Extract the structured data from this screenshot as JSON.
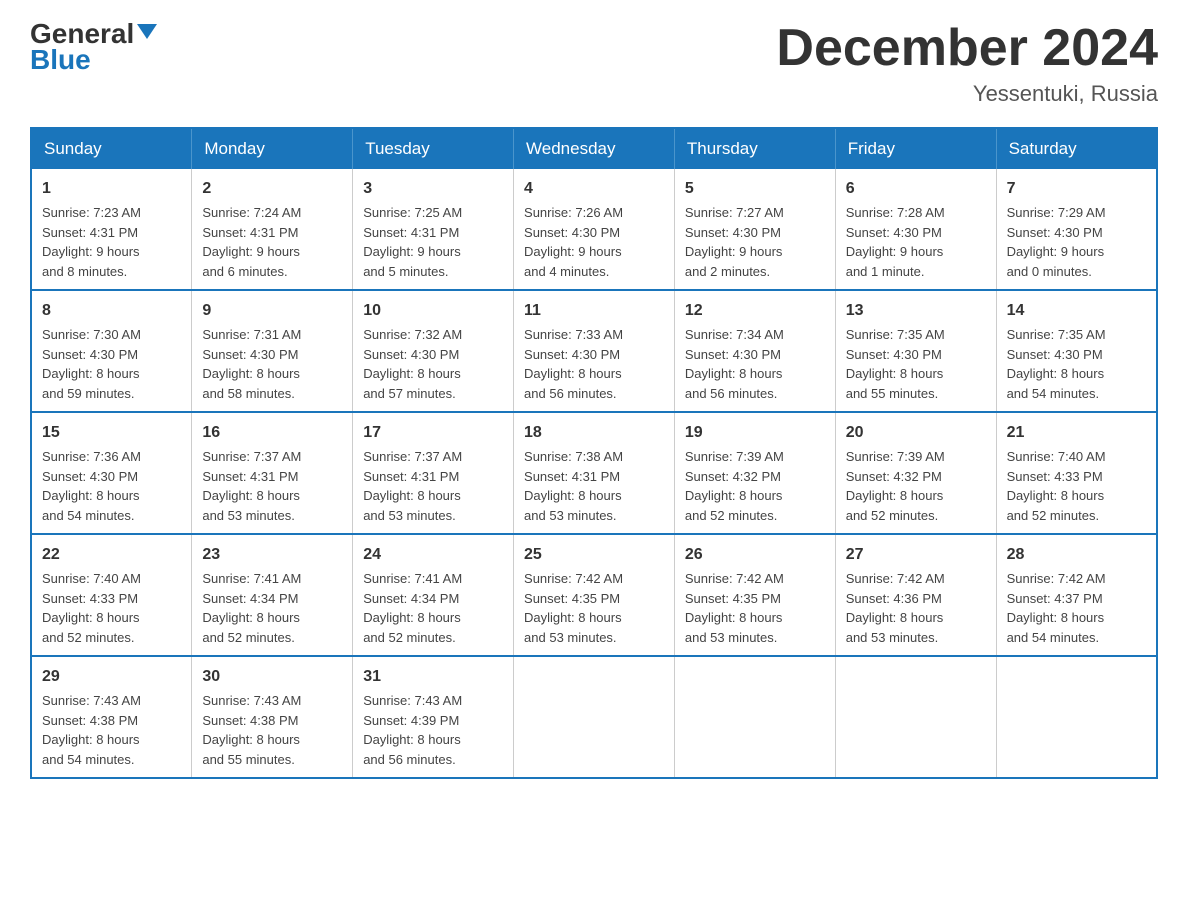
{
  "header": {
    "logo_line1": "General",
    "logo_line2": "Blue",
    "month_title": "December 2024",
    "location": "Yessentuki, Russia"
  },
  "days_of_week": [
    "Sunday",
    "Monday",
    "Tuesday",
    "Wednesday",
    "Thursday",
    "Friday",
    "Saturday"
  ],
  "weeks": [
    [
      {
        "day": "1",
        "sunrise": "Sunrise: 7:23 AM",
        "sunset": "Sunset: 4:31 PM",
        "daylight": "Daylight: 9 hours",
        "daylight2": "and 8 minutes."
      },
      {
        "day": "2",
        "sunrise": "Sunrise: 7:24 AM",
        "sunset": "Sunset: 4:31 PM",
        "daylight": "Daylight: 9 hours",
        "daylight2": "and 6 minutes."
      },
      {
        "day": "3",
        "sunrise": "Sunrise: 7:25 AM",
        "sunset": "Sunset: 4:31 PM",
        "daylight": "Daylight: 9 hours",
        "daylight2": "and 5 minutes."
      },
      {
        "day": "4",
        "sunrise": "Sunrise: 7:26 AM",
        "sunset": "Sunset: 4:30 PM",
        "daylight": "Daylight: 9 hours",
        "daylight2": "and 4 minutes."
      },
      {
        "day": "5",
        "sunrise": "Sunrise: 7:27 AM",
        "sunset": "Sunset: 4:30 PM",
        "daylight": "Daylight: 9 hours",
        "daylight2": "and 2 minutes."
      },
      {
        "day": "6",
        "sunrise": "Sunrise: 7:28 AM",
        "sunset": "Sunset: 4:30 PM",
        "daylight": "Daylight: 9 hours",
        "daylight2": "and 1 minute."
      },
      {
        "day": "7",
        "sunrise": "Sunrise: 7:29 AM",
        "sunset": "Sunset: 4:30 PM",
        "daylight": "Daylight: 9 hours",
        "daylight2": "and 0 minutes."
      }
    ],
    [
      {
        "day": "8",
        "sunrise": "Sunrise: 7:30 AM",
        "sunset": "Sunset: 4:30 PM",
        "daylight": "Daylight: 8 hours",
        "daylight2": "and 59 minutes."
      },
      {
        "day": "9",
        "sunrise": "Sunrise: 7:31 AM",
        "sunset": "Sunset: 4:30 PM",
        "daylight": "Daylight: 8 hours",
        "daylight2": "and 58 minutes."
      },
      {
        "day": "10",
        "sunrise": "Sunrise: 7:32 AM",
        "sunset": "Sunset: 4:30 PM",
        "daylight": "Daylight: 8 hours",
        "daylight2": "and 57 minutes."
      },
      {
        "day": "11",
        "sunrise": "Sunrise: 7:33 AM",
        "sunset": "Sunset: 4:30 PM",
        "daylight": "Daylight: 8 hours",
        "daylight2": "and 56 minutes."
      },
      {
        "day": "12",
        "sunrise": "Sunrise: 7:34 AM",
        "sunset": "Sunset: 4:30 PM",
        "daylight": "Daylight: 8 hours",
        "daylight2": "and 56 minutes."
      },
      {
        "day": "13",
        "sunrise": "Sunrise: 7:35 AM",
        "sunset": "Sunset: 4:30 PM",
        "daylight": "Daylight: 8 hours",
        "daylight2": "and 55 minutes."
      },
      {
        "day": "14",
        "sunrise": "Sunrise: 7:35 AM",
        "sunset": "Sunset: 4:30 PM",
        "daylight": "Daylight: 8 hours",
        "daylight2": "and 54 minutes."
      }
    ],
    [
      {
        "day": "15",
        "sunrise": "Sunrise: 7:36 AM",
        "sunset": "Sunset: 4:30 PM",
        "daylight": "Daylight: 8 hours",
        "daylight2": "and 54 minutes."
      },
      {
        "day": "16",
        "sunrise": "Sunrise: 7:37 AM",
        "sunset": "Sunset: 4:31 PM",
        "daylight": "Daylight: 8 hours",
        "daylight2": "and 53 minutes."
      },
      {
        "day": "17",
        "sunrise": "Sunrise: 7:37 AM",
        "sunset": "Sunset: 4:31 PM",
        "daylight": "Daylight: 8 hours",
        "daylight2": "and 53 minutes."
      },
      {
        "day": "18",
        "sunrise": "Sunrise: 7:38 AM",
        "sunset": "Sunset: 4:31 PM",
        "daylight": "Daylight: 8 hours",
        "daylight2": "and 53 minutes."
      },
      {
        "day": "19",
        "sunrise": "Sunrise: 7:39 AM",
        "sunset": "Sunset: 4:32 PM",
        "daylight": "Daylight: 8 hours",
        "daylight2": "and 52 minutes."
      },
      {
        "day": "20",
        "sunrise": "Sunrise: 7:39 AM",
        "sunset": "Sunset: 4:32 PM",
        "daylight": "Daylight: 8 hours",
        "daylight2": "and 52 minutes."
      },
      {
        "day": "21",
        "sunrise": "Sunrise: 7:40 AM",
        "sunset": "Sunset: 4:33 PM",
        "daylight": "Daylight: 8 hours",
        "daylight2": "and 52 minutes."
      }
    ],
    [
      {
        "day": "22",
        "sunrise": "Sunrise: 7:40 AM",
        "sunset": "Sunset: 4:33 PM",
        "daylight": "Daylight: 8 hours",
        "daylight2": "and 52 minutes."
      },
      {
        "day": "23",
        "sunrise": "Sunrise: 7:41 AM",
        "sunset": "Sunset: 4:34 PM",
        "daylight": "Daylight: 8 hours",
        "daylight2": "and 52 minutes."
      },
      {
        "day": "24",
        "sunrise": "Sunrise: 7:41 AM",
        "sunset": "Sunset: 4:34 PM",
        "daylight": "Daylight: 8 hours",
        "daylight2": "and 52 minutes."
      },
      {
        "day": "25",
        "sunrise": "Sunrise: 7:42 AM",
        "sunset": "Sunset: 4:35 PM",
        "daylight": "Daylight: 8 hours",
        "daylight2": "and 53 minutes."
      },
      {
        "day": "26",
        "sunrise": "Sunrise: 7:42 AM",
        "sunset": "Sunset: 4:35 PM",
        "daylight": "Daylight: 8 hours",
        "daylight2": "and 53 minutes."
      },
      {
        "day": "27",
        "sunrise": "Sunrise: 7:42 AM",
        "sunset": "Sunset: 4:36 PM",
        "daylight": "Daylight: 8 hours",
        "daylight2": "and 53 minutes."
      },
      {
        "day": "28",
        "sunrise": "Sunrise: 7:42 AM",
        "sunset": "Sunset: 4:37 PM",
        "daylight": "Daylight: 8 hours",
        "daylight2": "and 54 minutes."
      }
    ],
    [
      {
        "day": "29",
        "sunrise": "Sunrise: 7:43 AM",
        "sunset": "Sunset: 4:38 PM",
        "daylight": "Daylight: 8 hours",
        "daylight2": "and 54 minutes."
      },
      {
        "day": "30",
        "sunrise": "Sunrise: 7:43 AM",
        "sunset": "Sunset: 4:38 PM",
        "daylight": "Daylight: 8 hours",
        "daylight2": "and 55 minutes."
      },
      {
        "day": "31",
        "sunrise": "Sunrise: 7:43 AM",
        "sunset": "Sunset: 4:39 PM",
        "daylight": "Daylight: 8 hours",
        "daylight2": "and 56 minutes."
      },
      null,
      null,
      null,
      null
    ]
  ]
}
